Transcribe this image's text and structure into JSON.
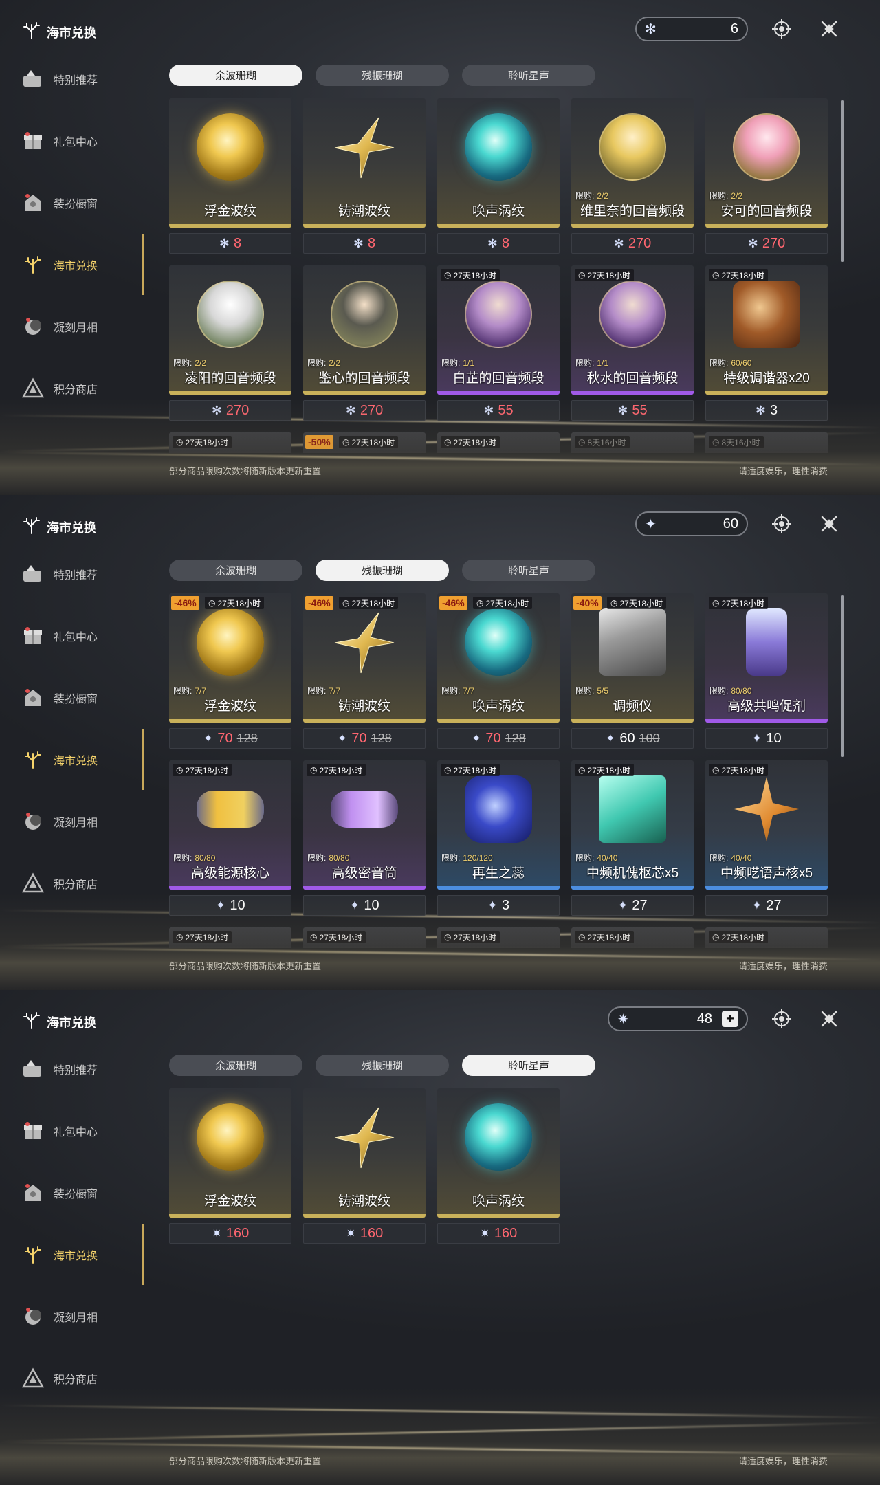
{
  "panels": [
    {
      "title": "海市兑换",
      "currency": {
        "value": "6",
        "icon": "coral-icon",
        "has_plus": false
      },
      "sidebar": [
        {
          "label": "特别推荐",
          "icon": "recommend-icon"
        },
        {
          "label": "礼包中心",
          "icon": "gift-icon"
        },
        {
          "label": "装扮橱窗",
          "icon": "wardrobe-icon"
        },
        {
          "label": "海市兑换",
          "icon": "coral-icon",
          "active": true
        },
        {
          "label": "凝刻月相",
          "icon": "moon-icon"
        },
        {
          "label": "积分商店",
          "icon": "triangle-icon"
        }
      ],
      "tabs": [
        {
          "label": "余波珊瑚",
          "active": true
        },
        {
          "label": "残振珊瑚",
          "active": false
        },
        {
          "label": "聆听星声",
          "active": false
        }
      ],
      "items": [
        {
          "name": "浮金波纹",
          "art": "orb-gold",
          "price": "8",
          "price_color": "red",
          "strip": "gold"
        },
        {
          "name": "铸潮波纹",
          "art": "blade",
          "price": "8",
          "price_color": "red",
          "strip": "gold"
        },
        {
          "name": "唤声涡纹",
          "art": "orb-teal",
          "price": "8",
          "price_color": "red",
          "strip": "gold"
        },
        {
          "name": "维里奈的回音频段",
          "art": "portrait yel",
          "limit_label": "限购:",
          "limit": "2/2",
          "price": "270",
          "price_color": "red",
          "strip": "gold"
        },
        {
          "name": "安可的回音频段",
          "art": "portrait pink",
          "limit_label": "限购:",
          "limit": "2/2",
          "price": "270",
          "price_color": "red",
          "strip": "gold"
        },
        {
          "name": "凌阳的回音频段",
          "art": "portrait wht",
          "limit_label": "限购:",
          "limit": "2/2",
          "price": "270",
          "price_color": "red",
          "strip": "gold"
        },
        {
          "name": "鉴心的回音频段",
          "art": "portrait dk",
          "limit_label": "限购:",
          "limit": "2/2",
          "price": "270",
          "price_color": "red",
          "strip": "gold"
        },
        {
          "name": "白芷的回音频段",
          "art": "portrait pp",
          "timer": "27天18小时",
          "limit_label": "限购:",
          "limit": "1/1",
          "price": "55",
          "price_color": "red",
          "strip": "purple"
        },
        {
          "name": "秋水的回音频段",
          "art": "portrait pp",
          "timer": "27天18小时",
          "limit_label": "限购:",
          "limit": "1/1",
          "price": "55",
          "price_color": "red",
          "strip": "purple"
        },
        {
          "name": "特级调谐器x20",
          "art": "box",
          "timer": "27天18小时",
          "limit_label": "限购:",
          "limit": "60/60",
          "price": "3",
          "price_color": "white",
          "strip": "gold"
        }
      ],
      "partials": [
        {
          "timer": "27天18小时"
        },
        {
          "discount": "-50%",
          "timer": "27天18小时"
        },
        {
          "timer": "27天18小时"
        },
        {
          "timer": "8天16小时",
          "dim": true
        },
        {
          "timer": "8天16小时",
          "dim": true
        }
      ],
      "footer_left": "部分商品限购次数将随新版本更新重置",
      "footer_right": "请适度娱乐，理性消费"
    },
    {
      "title": "海市兑换",
      "currency": {
        "value": "60",
        "icon": "crystal-icon",
        "has_plus": false
      },
      "sidebar": [
        {
          "label": "特别推荐",
          "icon": "recommend-icon"
        },
        {
          "label": "礼包中心",
          "icon": "gift-icon"
        },
        {
          "label": "装扮橱窗",
          "icon": "wardrobe-icon"
        },
        {
          "label": "海市兑换",
          "icon": "coral-icon",
          "active": true
        },
        {
          "label": "凝刻月相",
          "icon": "moon-icon"
        },
        {
          "label": "积分商店",
          "icon": "triangle-icon"
        }
      ],
      "tabs": [
        {
          "label": "余波珊瑚",
          "active": false
        },
        {
          "label": "残振珊瑚",
          "active": true
        },
        {
          "label": "聆听星声",
          "active": false
        }
      ],
      "items": [
        {
          "name": "浮金波纹",
          "art": "orb-gold",
          "discount": "-46%",
          "timer": "27天18小时",
          "limit_label": "限购:",
          "limit": "7/7",
          "price": "70",
          "old_price": "128",
          "price_color": "red",
          "strip": "gold"
        },
        {
          "name": "铸潮波纹",
          "art": "blade",
          "discount": "-46%",
          "timer": "27天18小时",
          "limit_label": "限购:",
          "limit": "7/7",
          "price": "70",
          "old_price": "128",
          "price_color": "red",
          "strip": "gold"
        },
        {
          "name": "唤声涡纹",
          "art": "orb-teal",
          "discount": "-46%",
          "timer": "27天18小时",
          "limit_label": "限购:",
          "limit": "7/7",
          "price": "70",
          "old_price": "128",
          "price_color": "red",
          "strip": "gold"
        },
        {
          "name": "调频仪",
          "art": "device",
          "discount": "-40%",
          "timer": "27天18小时",
          "limit_label": "限购:",
          "limit": "5/5",
          "price": "60",
          "old_price": "100",
          "price_color": "white",
          "strip": "gold"
        },
        {
          "name": "高级共鸣促剂",
          "art": "vial",
          "timer": "27天18小时",
          "limit_label": "限购:",
          "limit": "80/80",
          "price": "10",
          "price_color": "white",
          "strip": "purple"
        },
        {
          "name": "高级能源核心",
          "art": "cap",
          "timer": "27天18小时",
          "limit_label": "限购:",
          "limit": "80/80",
          "price": "10",
          "price_color": "white",
          "strip": "purple"
        },
        {
          "name": "高级密音筒",
          "art": "cap purp",
          "timer": "27天18小时",
          "limit_label": "限购:",
          "limit": "80/80",
          "price": "10",
          "price_color": "white",
          "strip": "purple"
        },
        {
          "name": "再生之蕊",
          "art": "crystal",
          "timer": "27天18小时",
          "limit_label": "限购:",
          "limit": "120/120",
          "price": "3",
          "price_color": "white",
          "strip": "blue"
        },
        {
          "name": "中频机傀枢芯x5",
          "art": "cube",
          "timer": "27天18小时",
          "limit_label": "限购:",
          "limit": "40/40",
          "price": "27",
          "price_color": "white",
          "strip": "blue"
        },
        {
          "name": "中频呓语声核x5",
          "art": "star",
          "timer": "27天18小时",
          "limit_label": "限购:",
          "limit": "40/40",
          "price": "27",
          "price_color": "white",
          "strip": "blue"
        }
      ],
      "partials": [
        {
          "timer": "27天18小时"
        },
        {
          "timer": "27天18小时"
        },
        {
          "timer": "27天18小时"
        },
        {
          "timer": "27天18小时"
        },
        {
          "timer": "27天18小时"
        }
      ],
      "footer_left": "部分商品限购次数将随新版本更新重置",
      "footer_right": "请适度娱乐，理性消费"
    },
    {
      "title": "海市兑换",
      "currency": {
        "value": "48",
        "icon": "star-sound-icon",
        "has_plus": true,
        "plus": "+"
      },
      "sidebar": [
        {
          "label": "特别推荐",
          "icon": "recommend-icon"
        },
        {
          "label": "礼包中心",
          "icon": "gift-icon"
        },
        {
          "label": "装扮橱窗",
          "icon": "wardrobe-icon"
        },
        {
          "label": "海市兑换",
          "icon": "coral-icon",
          "active": true
        },
        {
          "label": "凝刻月相",
          "icon": "moon-icon"
        },
        {
          "label": "积分商店",
          "icon": "triangle-icon"
        }
      ],
      "tabs": [
        {
          "label": "余波珊瑚",
          "active": false
        },
        {
          "label": "残振珊瑚",
          "active": false
        },
        {
          "label": "聆听星声",
          "active": true
        }
      ],
      "items": [
        {
          "name": "浮金波纹",
          "art": "orb-gold",
          "price": "160",
          "price_color": "red",
          "strip": "gold"
        },
        {
          "name": "铸潮波纹",
          "art": "blade",
          "price": "160",
          "price_color": "red",
          "strip": "gold"
        },
        {
          "name": "唤声涡纹",
          "art": "orb-teal",
          "price": "160",
          "price_color": "red",
          "strip": "gold"
        }
      ],
      "partials": [],
      "footer_left": "部分商品限购次数将随新版本更新重置",
      "footer_right": "请适度娱乐，理性消费"
    }
  ]
}
